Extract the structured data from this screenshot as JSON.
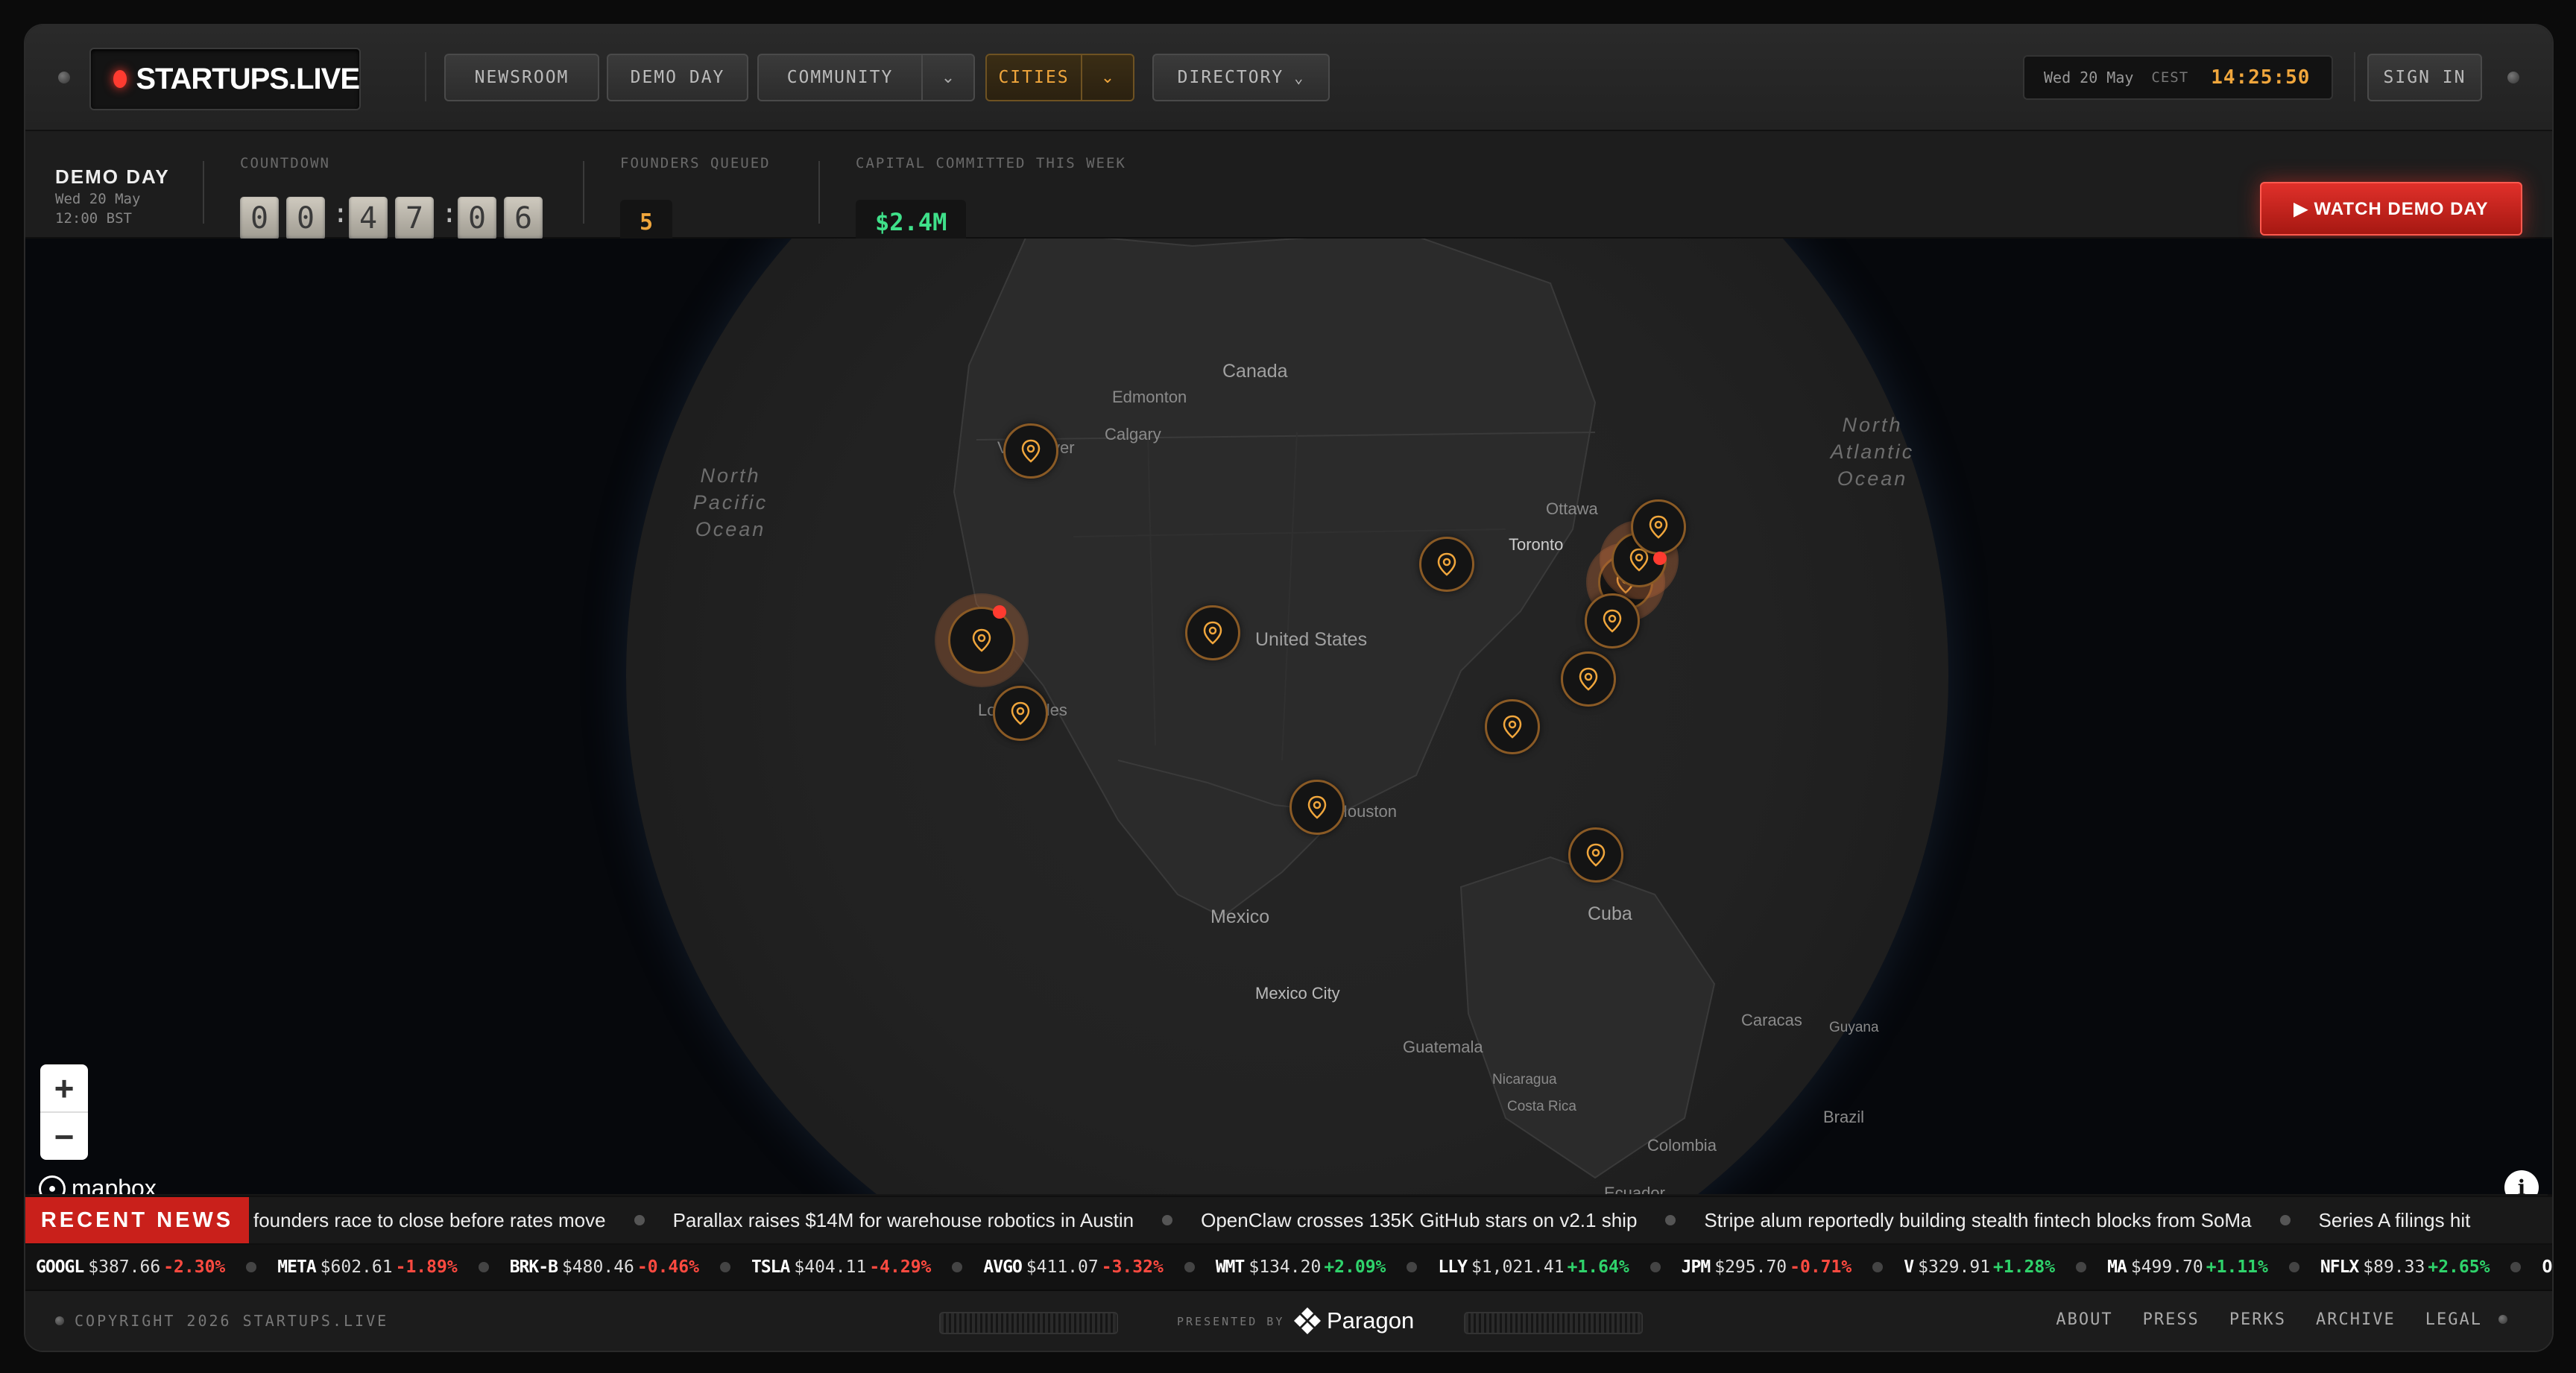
{
  "brand": {
    "name": "STARTUPS.LIVE"
  },
  "nav": {
    "newsroom": "NEWSROOM",
    "demo_day": "DEMO DAY",
    "community": "COMMUNITY",
    "cities": "CITIES",
    "directory": "DIRECTORY",
    "sign_in": "SIGN IN"
  },
  "clock": {
    "date": "Wed 20 May",
    "tz": "CEST",
    "time": "14:25:50"
  },
  "demo": {
    "title": "DEMO DAY",
    "date": "Wed 20 May",
    "time": "12:00 BST",
    "countdown_label": "COUNTDOWN",
    "countdown_digits": [
      "0",
      "0",
      "4",
      "7",
      "0",
      "6"
    ],
    "founders_label": "FOUNDERS QUEUED",
    "founders_value": "5",
    "capital_label": "CAPITAL COMMITTED THIS WEEK",
    "capital_value": "$2.4M",
    "watch_label": "▶ WATCH DEMO DAY"
  },
  "map": {
    "labels": {
      "canada": "Canada",
      "edmonton": "Edmonton",
      "calgary": "Calgary",
      "vancouver": "Vancouver",
      "united_states": "United States",
      "ottawa": "Ottawa",
      "toronto": "Toronto",
      "los_angeles": "Los Angeles",
      "houston": "Houston",
      "mexico": "Mexico",
      "mexico_city": "Mexico City",
      "cuba": "Cuba",
      "guatemala": "Guatemala",
      "nicaragua": "Nicaragua",
      "costa_rica": "Costa Rica",
      "caracas": "Caracas",
      "guyana": "Guyana",
      "brazil": "Brazil",
      "colombia": "Colombia",
      "ecuador": "Ecuador",
      "north_pacific": "North\nPacific\nOcean",
      "north_atlantic": "North\nAtlantic\nOcean"
    },
    "zoom_in": "+",
    "zoom_out": "−",
    "attribution": "mapbox"
  },
  "news": {
    "label": "RECENT NEWS",
    "items": [
      "founders race to close before rates move",
      "Parallax raises $14M for warehouse robotics in Austin",
      "OpenClaw crosses 135K GitHub stars on v2.1 ship",
      "Stripe alum reportedly building stealth fintech blocks from SoMa",
      "Series A filings hit"
    ]
  },
  "stocks": [
    {
      "sym": "GOOGL",
      "price": "$387.66",
      "chg": "-2.30%",
      "dir": "down"
    },
    {
      "sym": "META",
      "price": "$602.61",
      "chg": "-1.89%",
      "dir": "down"
    },
    {
      "sym": "BRK-B",
      "price": "$480.46",
      "chg": "-0.46%",
      "dir": "down"
    },
    {
      "sym": "TSLA",
      "price": "$404.11",
      "chg": "-4.29%",
      "dir": "down"
    },
    {
      "sym": "AVGO",
      "price": "$411.07",
      "chg": "-3.32%",
      "dir": "down"
    },
    {
      "sym": "WMT",
      "price": "$134.20",
      "chg": "+2.09%",
      "dir": "up"
    },
    {
      "sym": "LLY",
      "price": "$1,021.41",
      "chg": "+1.64%",
      "dir": "up"
    },
    {
      "sym": "JPM",
      "price": "$295.70",
      "chg": "-0.71%",
      "dir": "down"
    },
    {
      "sym": "V",
      "price": "$329.91",
      "chg": "+1.28%",
      "dir": "up"
    },
    {
      "sym": "MA",
      "price": "$499.70",
      "chg": "+1.11%",
      "dir": "up"
    },
    {
      "sym": "NFLX",
      "price": "$89.33",
      "chg": "+2.65%",
      "dir": "up"
    },
    {
      "sym": "OR",
      "price": "",
      "chg": "",
      "dir": "up"
    }
  ],
  "footer": {
    "copyright": "COPYRIGHT 2026 STARTUPS.LIVE",
    "presented": "PRESENTED BY",
    "sponsor": "Paragon",
    "links": [
      "ABOUT",
      "PRESS",
      "PERKS",
      "ARCHIVE",
      "LEGAL"
    ]
  },
  "colors": {
    "accent": "#f0a63c",
    "danger": "#e0302a",
    "positive": "#2fd36b",
    "negative": "#ff4a40"
  }
}
